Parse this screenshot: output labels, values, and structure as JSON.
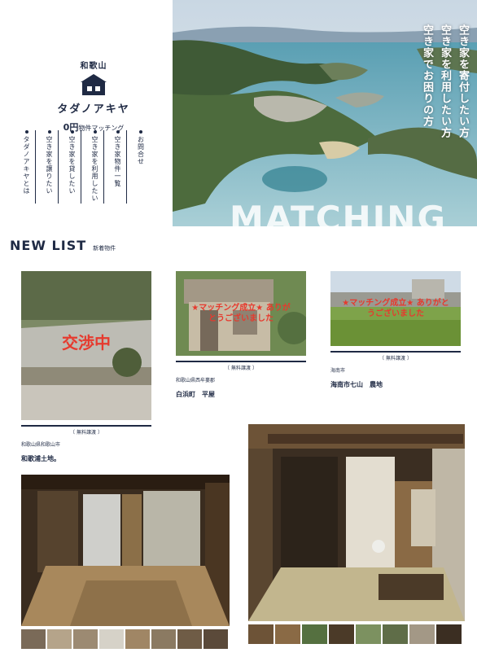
{
  "brand": {
    "region": "和歌山",
    "name": "タダノアキヤ",
    "tag_prefix": "0円",
    "tag_rest": "物件マッチング"
  },
  "nav": [
    {
      "label": "タダノアキヤとは"
    },
    {
      "label": "空き家を譲りたい"
    },
    {
      "label": "空き家を貸したい"
    },
    {
      "label": "空き家を利用したい"
    },
    {
      "label": "空き家物件一覧"
    },
    {
      "label": "お問合せ"
    }
  ],
  "hero": {
    "lines": [
      "空き家を寄付したい方",
      "空き家を利用したい方",
      "空き家でお困りの方"
    ],
    "word": "MATCHING"
  },
  "newlist": {
    "title": "NEW LIST",
    "subtitle": "新着物件"
  },
  "listings": [
    {
      "stamp": "交渉中",
      "type": "〔 無料譲渡 〕",
      "location": "和歌山県和歌山市",
      "title": "和歌浦土地。"
    },
    {
      "stamp": "★マッチング成立★ ありがとうございました",
      "type": "〔 無料譲渡 〕",
      "location": "和歌山県西牟婁郡",
      "title": "白浜町　平屋"
    },
    {
      "stamp": "★マッチング成立★ ありがとうございました",
      "type": "〔 無料譲渡 〕",
      "location": "海南市",
      "title": "海南市七山　農地"
    }
  ],
  "colors": {
    "navy": "#1f2a44",
    "stamp_red": "#e63a2e",
    "sea": "#4aa6b8"
  }
}
